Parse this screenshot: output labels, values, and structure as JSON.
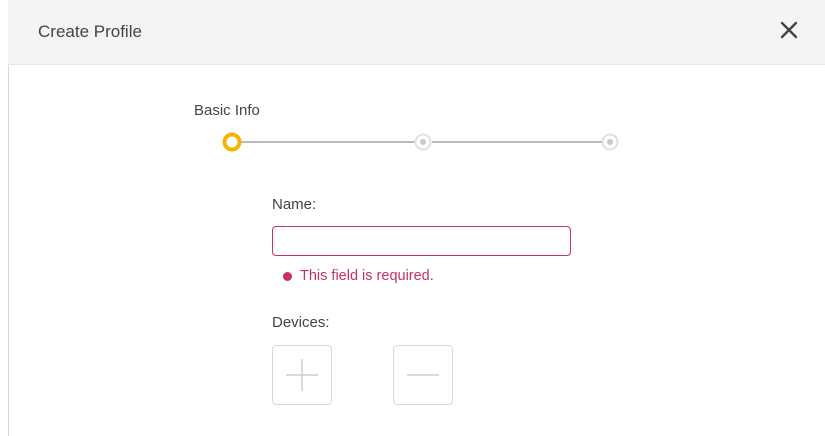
{
  "dialog": {
    "title": "Create Profile",
    "close_icon": "close-icon"
  },
  "stepper": {
    "current_step_label": "Basic Info",
    "steps_total": 3,
    "current_step_index": 0,
    "colors": {
      "active": "#f5b500",
      "inactive": "#cfcfcf",
      "line": "#b9b9b9"
    }
  },
  "form": {
    "name_label": "Name:",
    "name_value": "",
    "name_placeholder": "",
    "error_message": "This field is required.",
    "error_color": "#c4316c",
    "devices_label": "Devices:",
    "add_icon": "plus-icon",
    "remove_icon": "minus-icon"
  }
}
